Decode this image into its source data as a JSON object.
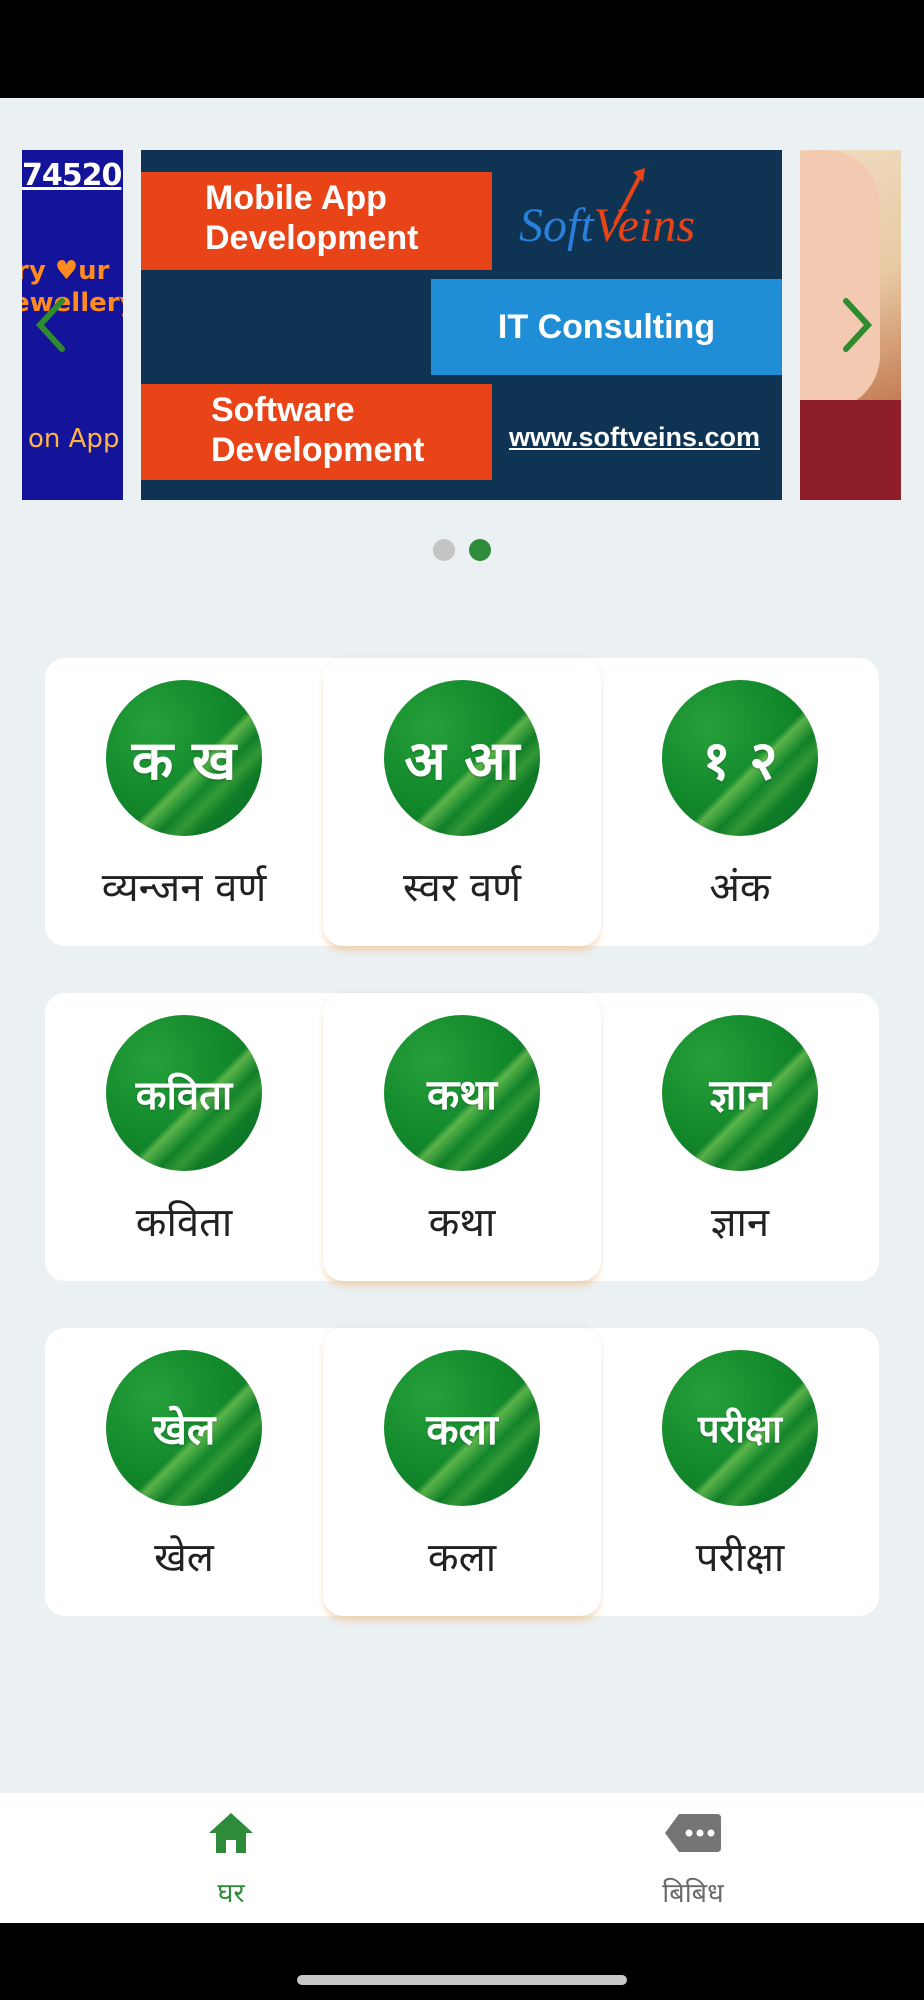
{
  "carousel": {
    "left_slide": {
      "phone": "74520",
      "line1": "ry ♥ur",
      "line2": "ewellery",
      "line3": "on App"
    },
    "main_slide": {
      "block1": "Mobile App\nDevelopment",
      "block2": "IT Consulting",
      "block3": "Software\nDevelopment",
      "brand_soft": "Soft",
      "brand_veins": "Veins",
      "url": "www.softveins.com"
    },
    "prev_icon": "chevron-left-icon",
    "next_icon": "chevron-right-icon",
    "dot_count": 2,
    "active_dot": 1
  },
  "menu": {
    "rows": [
      [
        {
          "icon_text": "क  ख",
          "label": "व्यन्जन वर्ण"
        },
        {
          "icon_text": "अ  आ",
          "label": "स्वर वर्ण"
        },
        {
          "icon_text": "१  २",
          "label": "अंक"
        }
      ],
      [
        {
          "icon_text": "कविता",
          "label": "कविता"
        },
        {
          "icon_text": "कथा",
          "label": "कथा"
        },
        {
          "icon_text": "ज्ञान",
          "label": "ज्ञान"
        }
      ],
      [
        {
          "icon_text": "खेल",
          "label": "खेल"
        },
        {
          "icon_text": "कला",
          "label": "कला"
        },
        {
          "icon_text": "परीक्षा",
          "label": "परीक्षा"
        }
      ]
    ]
  },
  "bottom_nav": {
    "home": {
      "label": "घर",
      "icon": "home-icon",
      "active": true
    },
    "misc": {
      "label": "बिबिध",
      "icon": "more-icon",
      "active": false
    }
  },
  "colors": {
    "accent": "#2e8b3a",
    "background": "#ebf0f3",
    "orange_block": "#e94417",
    "blue_block": "#1f8ed6",
    "navy_banner": "#0f3353"
  }
}
